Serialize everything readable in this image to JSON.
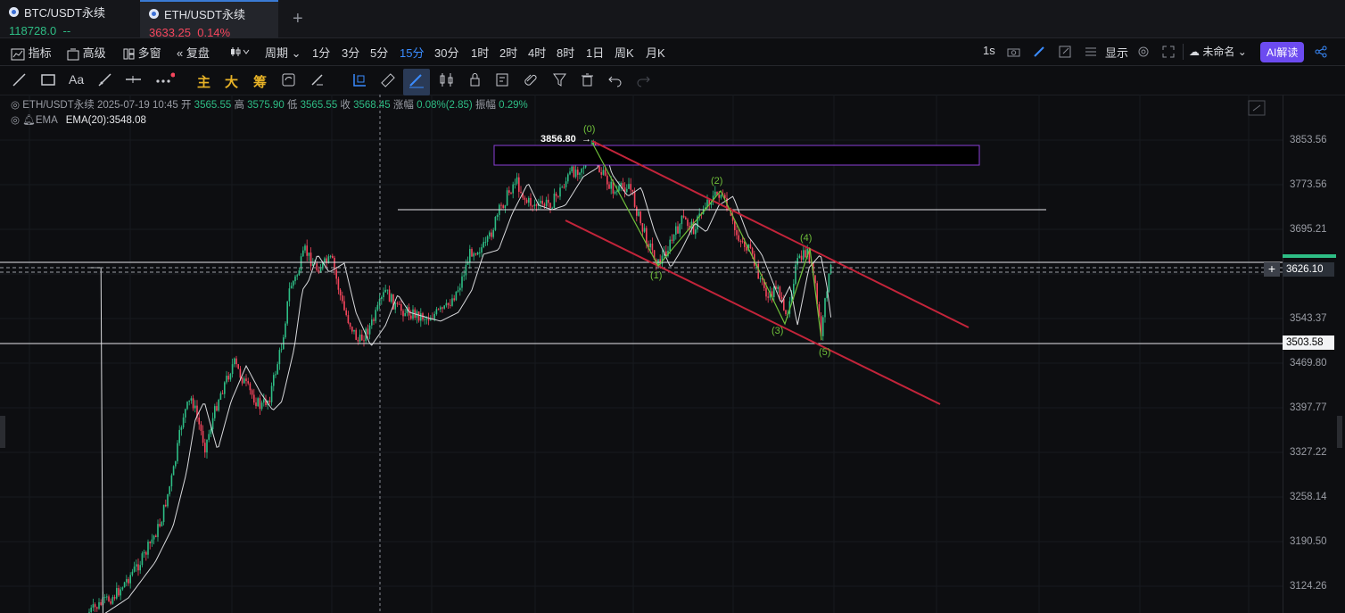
{
  "tabs": [
    {
      "symbol": "BTC/USDT永续",
      "price": "118728.0",
      "change": "--",
      "price_color": "#2ebd85"
    },
    {
      "symbol": "ETH/USDT永续",
      "price": "3633.25",
      "change": "0.14%",
      "price_color": "#f6465d"
    }
  ],
  "toolbar": {
    "indicators": "指标",
    "advanced": "高级",
    "multi_window": "多窗",
    "replay": "复盘",
    "period": "周期",
    "intervals": [
      "1分",
      "3分",
      "5分",
      "15分",
      "30分",
      "1时",
      "2时",
      "4时",
      "8时",
      "1日",
      "周K",
      "月K"
    ],
    "active_interval": "15分",
    "refresh": "1s",
    "display": "显示",
    "layout_name": "未命名",
    "ai_label": "AI解读"
  },
  "drawtools": {
    "main": "主",
    "big": "大",
    "chips": "筹",
    "text_tool": "Aa"
  },
  "ohlc": {
    "symbol": "ETH/USDT永续",
    "datetime": "2025-07-19 10:45",
    "open_label": "开",
    "open": "3565.55",
    "high_label": "高",
    "high": "3575.90",
    "low_label": "低",
    "low": "3565.55",
    "close_label": "收",
    "close": "3568.45",
    "change_label": "涨幅",
    "change": "0.08%(2.85)",
    "amp_label": "振幅",
    "amp": "0.29%"
  },
  "ema": {
    "label": "EMA",
    "value": "EMA(20):3548.08"
  },
  "axis": {
    "ticks": [
      "3853.56",
      "3773.56",
      "3695.21",
      "3543.37",
      "3469.80",
      "3397.77",
      "3327.22",
      "3258.14",
      "3190.50",
      "3124.26"
    ],
    "current_price": "3626.10",
    "level_price": "3503.58"
  },
  "annotations": {
    "peak": "3856.80",
    "waves": [
      "(0)",
      "(1)",
      "(2)",
      "(3)",
      "(4)",
      "(5)"
    ]
  },
  "colors": {
    "up": "#2ebd85",
    "down": "#f6465d",
    "accent": "#3a8cff",
    "channel": "#c3243a",
    "box": "#8a3fd6",
    "wave": "#6fbf3a"
  }
}
